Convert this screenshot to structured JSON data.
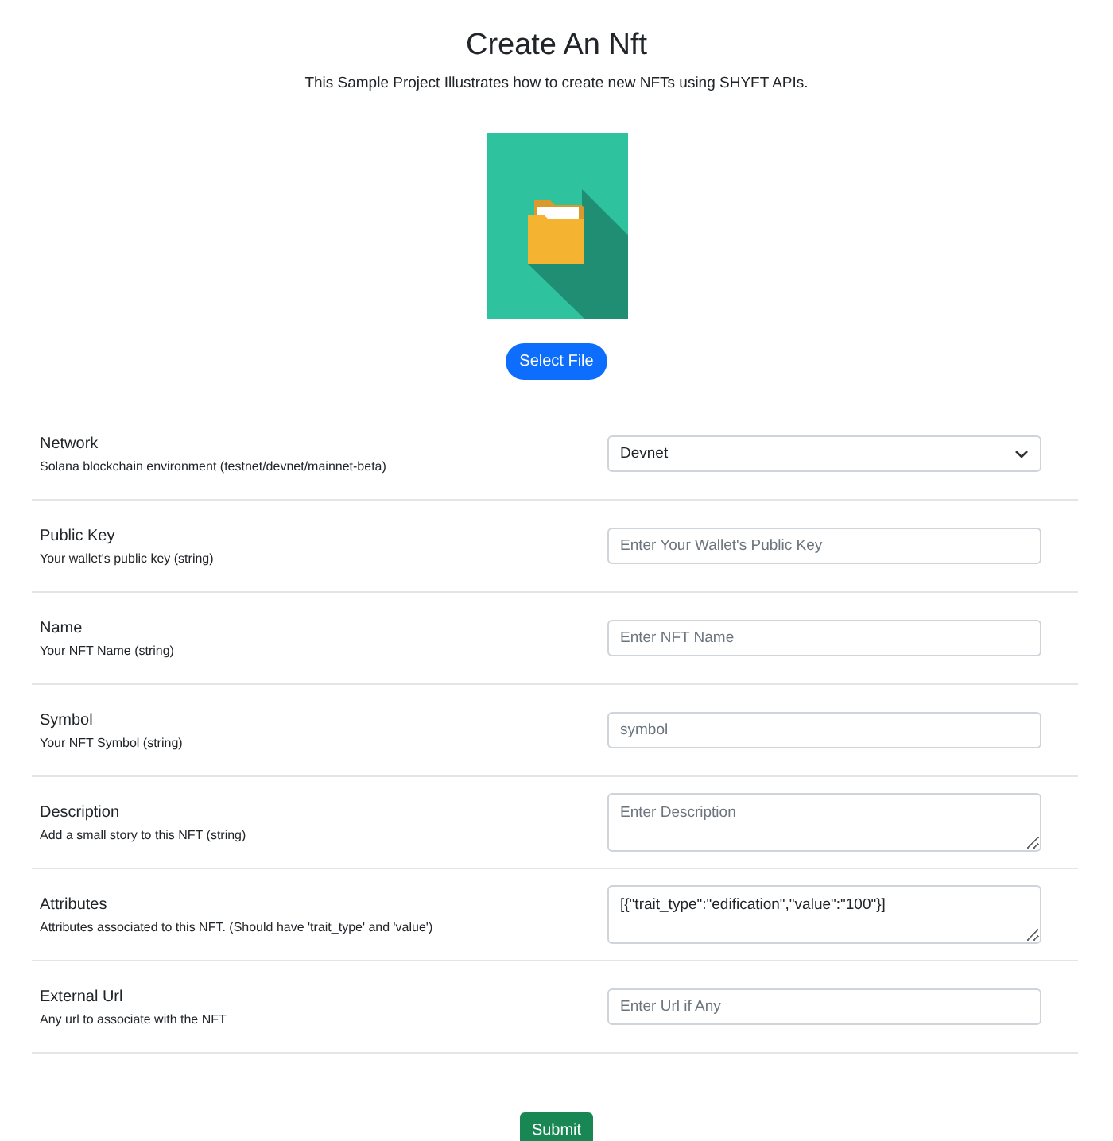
{
  "header": {
    "title": "Create An Nft",
    "subtitle": "This Sample Project Illustrates how to create new NFTs using SHYFT APIs."
  },
  "file_button": "Select File",
  "fields": [
    {
      "kind": "select",
      "label": "Network",
      "hint": "Solana blockchain environment (testnet/devnet/mainnet-beta)",
      "value": "Devnet"
    },
    {
      "kind": "input",
      "label": "Public Key",
      "hint": "Your wallet's public key (string)",
      "placeholder": "Enter Your Wallet's Public Key"
    },
    {
      "kind": "input",
      "label": "Name",
      "hint": "Your NFT Name (string)",
      "placeholder": "Enter NFT Name"
    },
    {
      "kind": "input",
      "label": "Symbol",
      "hint": "Your NFT Symbol (string)",
      "placeholder": "symbol"
    },
    {
      "kind": "textarea",
      "label": "Description",
      "hint": "Add a small story to this NFT (string)",
      "placeholder": "Enter Description"
    },
    {
      "kind": "textarea",
      "label": "Attributes",
      "hint": "Attributes associated to this NFT. (Should have 'trait_type' and 'value')",
      "value": "[{\"trait_type\":\"edification\",\"value\":\"100\"}]"
    },
    {
      "kind": "input",
      "label": "External Url",
      "hint": "Any url to associate with the NFT",
      "placeholder": "Enter Url if Any"
    }
  ],
  "submit_button": "Submit"
}
